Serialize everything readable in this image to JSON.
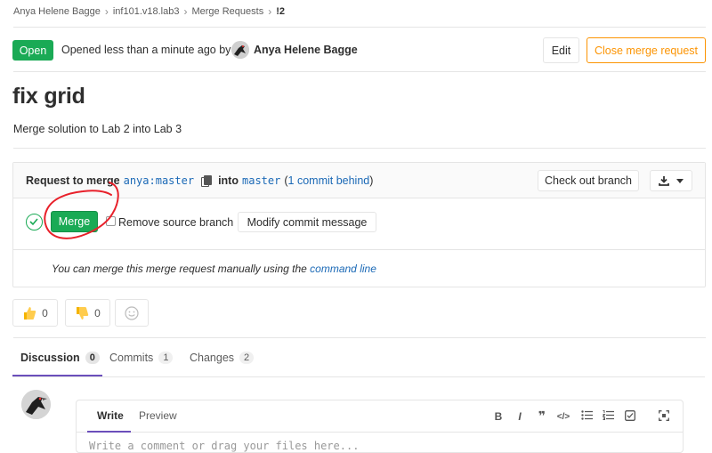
{
  "breadcrumb": {
    "items": [
      "Anya Helene Bagge",
      "inf101.v18.lab3",
      "Merge Requests",
      "!2"
    ]
  },
  "header": {
    "status": "Open",
    "opened_text": "Opened less than a minute ago by",
    "author": "Anya Helene Bagge",
    "edit_label": "Edit",
    "close_label": "Close merge request"
  },
  "title": "fix grid",
  "description": "Merge solution to Lab 2 into Lab 3",
  "widget": {
    "request_prefix": "Request to merge",
    "source_branch": "anya:master",
    "into_label": "into",
    "target_branch": "master",
    "open_paren": "(",
    "behind_link": "1 commit behind",
    "close_paren": ")",
    "checkout_label": "Check out branch",
    "merge_label": "Merge",
    "remove_source_label": "Remove source branch",
    "modify_commit_label": "Modify commit message",
    "manual_text": "You can merge this merge request manually using the",
    "command_line_link": "command line"
  },
  "awards": {
    "thumbs_up_count": "0",
    "thumbs_down_count": "0"
  },
  "tabs": [
    {
      "label": "Discussion",
      "count": "0"
    },
    {
      "label": "Commits",
      "count": "1"
    },
    {
      "label": "Changes",
      "count": "2"
    }
  ],
  "editor": {
    "write_tab": "Write",
    "preview_tab": "Preview",
    "placeholder": "Write a comment or drag your files here..."
  },
  "colors": {
    "success": "#1aaa55",
    "warning": "#fc9403",
    "link": "#1b69b6",
    "tab_active": "#6b4fbb",
    "annotation": "#e8202a"
  }
}
